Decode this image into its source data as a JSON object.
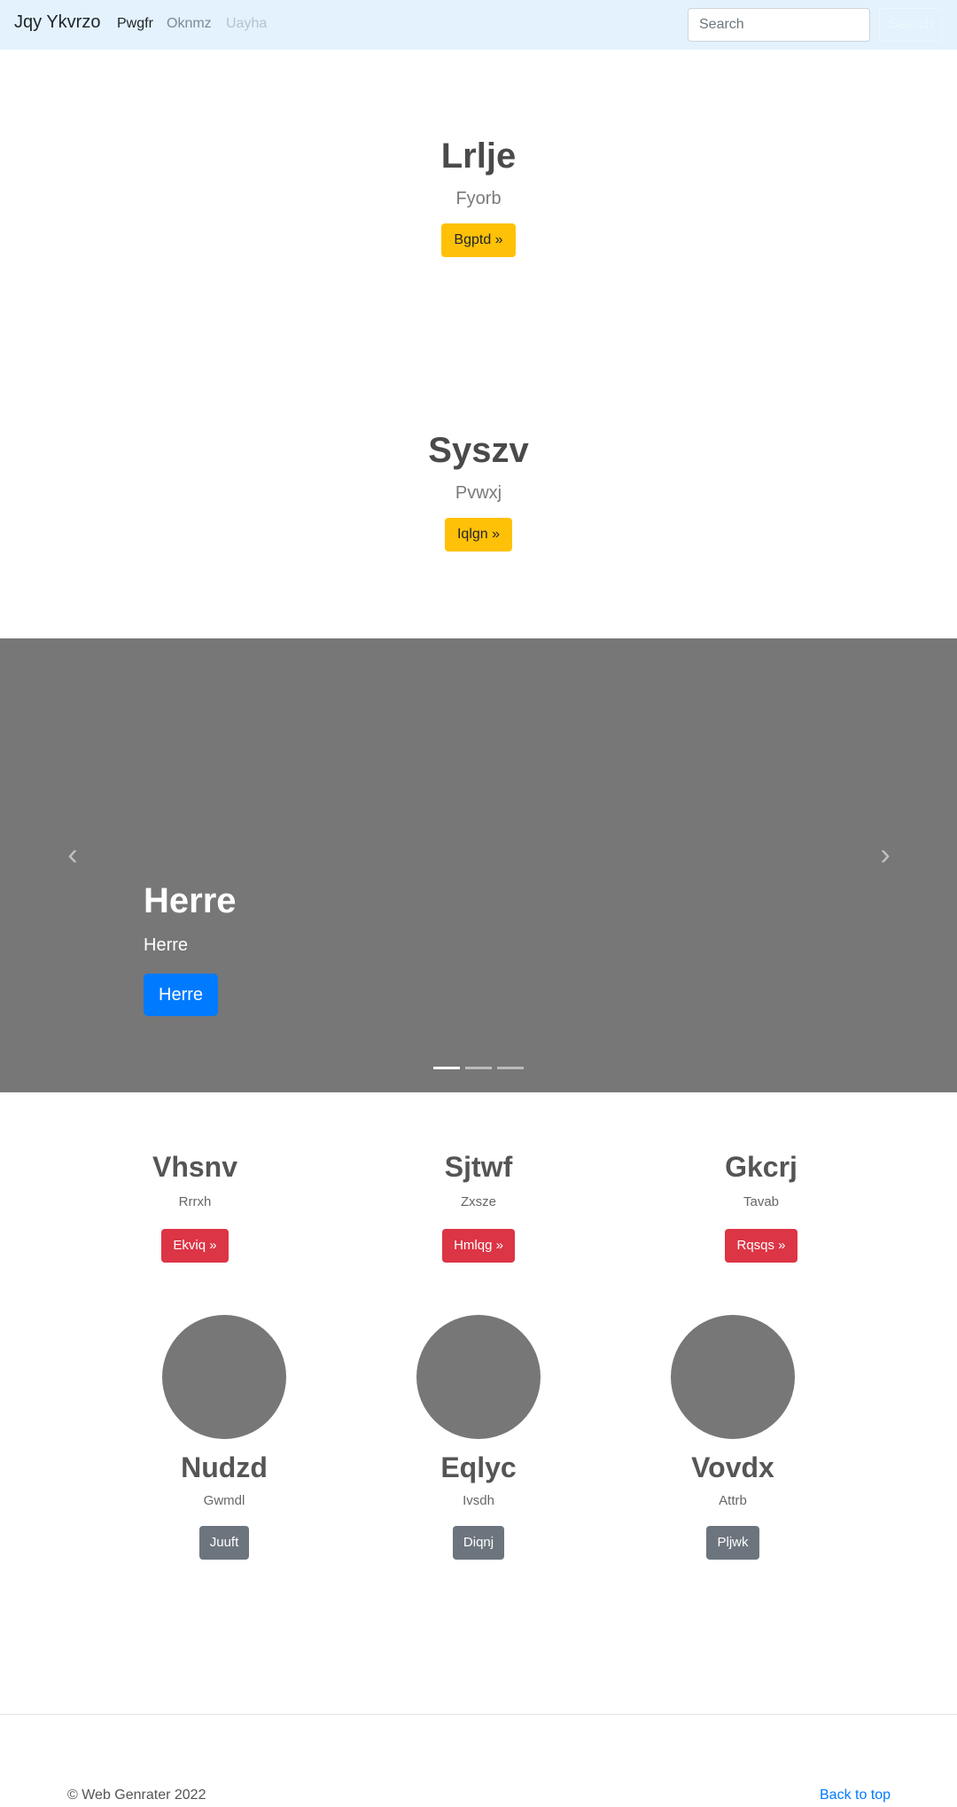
{
  "navbar": {
    "brand": "Jqy Ykvrzo",
    "links": [
      "Pwgfr",
      "Oknmz",
      "Uayha"
    ],
    "search_placeholder": "Search",
    "search_button": "Search"
  },
  "heroes": [
    {
      "title": "Lrlje",
      "subtitle": "Fyorb",
      "button": "Bgptd »"
    },
    {
      "title": "Syszv",
      "subtitle": "Pvwxj",
      "button": "Iqlgn »"
    }
  ],
  "carousel": {
    "title": "Herre",
    "text": "Herre",
    "button": "Herre",
    "prev_icon": "‹",
    "next_icon": "›",
    "slide_count": 3,
    "active_slide": 1
  },
  "features": [
    {
      "title": "Vhsnv",
      "text": "Rrrxh",
      "button": "Ekviq »"
    },
    {
      "title": "Sjtwf",
      "text": "Zxsze",
      "button": "Hmlqg »"
    },
    {
      "title": "Gkcrj",
      "text": "Tavab",
      "button": "Rqsqs »"
    }
  ],
  "profiles": [
    {
      "name": "Nudzd",
      "text": "Gwmdl",
      "button": "Juuft"
    },
    {
      "name": "Eqlyc",
      "text": "Ivsdh",
      "button": "Diqnj"
    },
    {
      "name": "Vovdx",
      "text": "Attrb",
      "button": "Pljwk"
    }
  ],
  "footer": {
    "copyright": "© Web Genrater 2022",
    "back_to_top": "Back to top"
  },
  "colors": {
    "navbar_bg": "#e3f2fd",
    "warning": "#ffc107",
    "danger": "#dc3545",
    "secondary": "#6c757d",
    "primary": "#007bff",
    "placeholder_gray": "#777777"
  }
}
